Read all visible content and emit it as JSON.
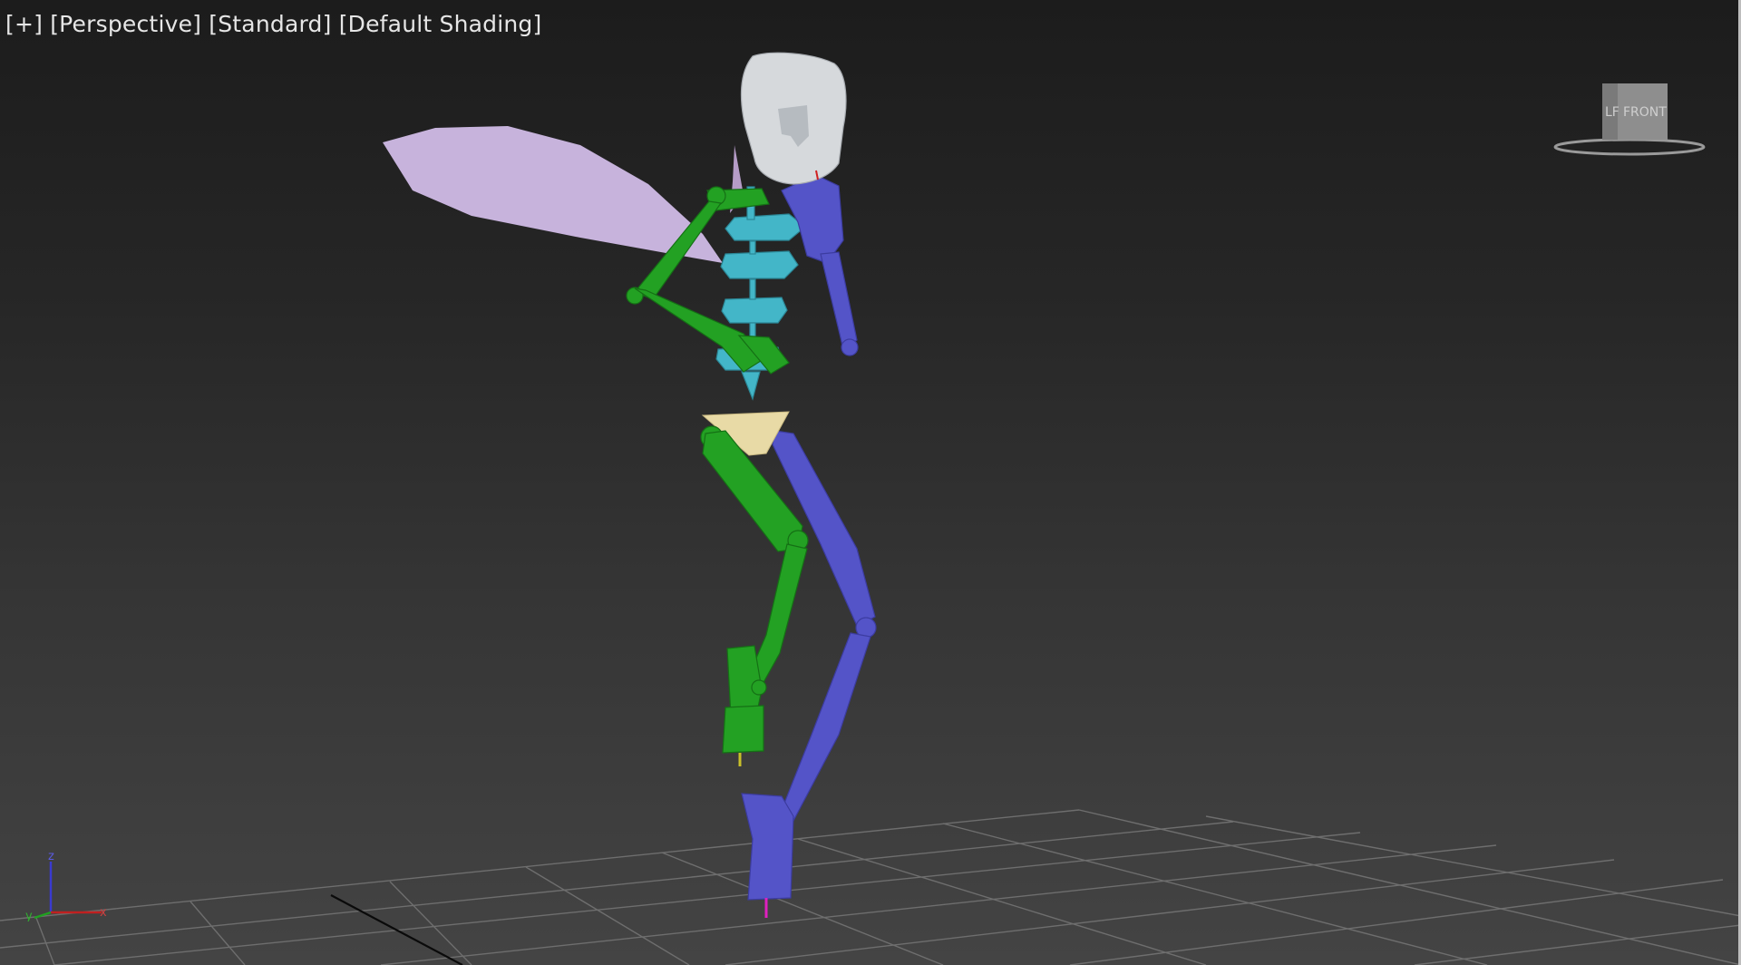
{
  "viewport": {
    "label_plus": "[+]",
    "label_view": "[Perspective]",
    "label_style": "[Standard]",
    "label_shading": "[Default Shading]"
  },
  "viewcube": {
    "face_front": "FRONT",
    "face_left": "LF",
    "icon": "viewcube-icon"
  },
  "axis_tripod": {
    "x_label": "x",
    "y_label": "y",
    "z_label": "z",
    "icon": "axis-tripod-icon"
  },
  "colors": {
    "left_limbs": "#23a123",
    "right_limbs": "#5454c8",
    "spine": "#43b6c8",
    "head": "#d6d9dc",
    "pelvis": "#e8daa6",
    "wing": "#c7b3dc",
    "grid": "#6b6b6b"
  }
}
